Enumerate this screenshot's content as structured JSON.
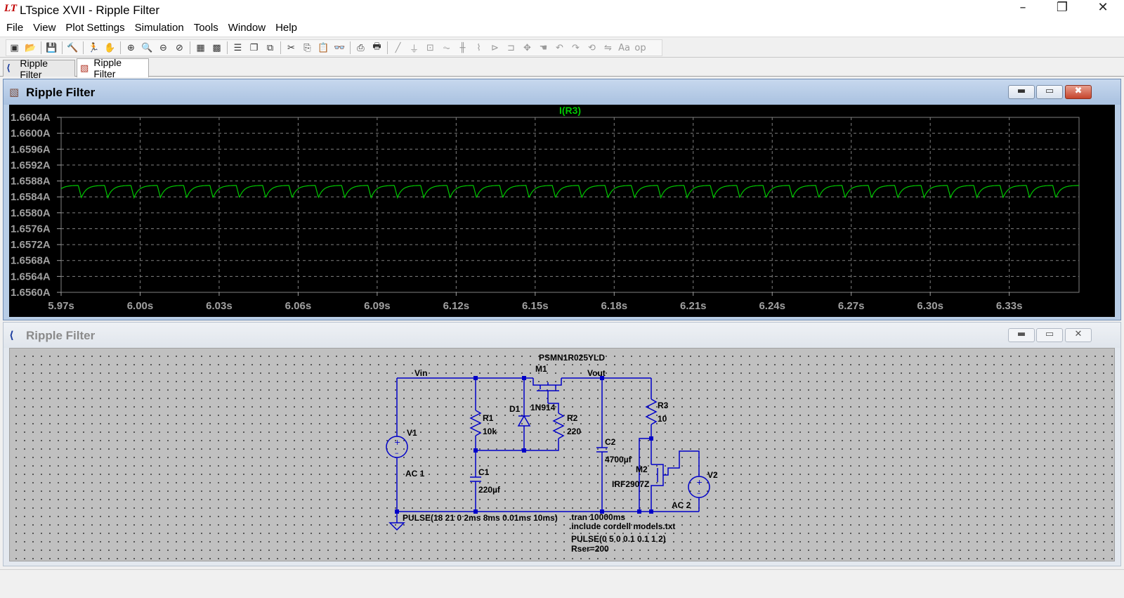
{
  "window": {
    "title": "LTspice XVII - Ripple Filter",
    "logo": "LT",
    "controls": {
      "minimize": "–",
      "maximize": "❐",
      "close": "✕"
    }
  },
  "menu": [
    "File",
    "View",
    "Plot Settings",
    "Simulation",
    "Tools",
    "Window",
    "Help"
  ],
  "toolbar": {
    "icons": [
      "new-schematic-icon",
      "open-icon",
      "sep",
      "save-icon",
      "sep",
      "control-panel-icon",
      "sep",
      "run-icon",
      "halt-icon",
      "sep",
      "zoom-in-icon",
      "zoom-box-icon",
      "zoom-out-icon",
      "zoom-cancel-icon",
      "sep",
      "autorange-icon",
      "plot-settings-icon",
      "sep",
      "tile-horizontal-icon",
      "cascade-icon",
      "tile-vertical-icon",
      "sep",
      "cut-icon",
      "copy-icon",
      "paste-icon",
      "find-icon",
      "sep",
      "print-preview-icon",
      "print-icon",
      "sep",
      "wire-icon",
      "ground-icon",
      "label-net-icon",
      "resistor-icon",
      "capacitor-icon",
      "inductor-icon",
      "diode-icon",
      "component-icon",
      "move-icon",
      "drag-icon",
      "undo-icon",
      "redo-icon",
      "rotate-icon",
      "mirror-icon",
      "text-icon",
      "spice-directive-icon"
    ],
    "glyphs": {
      "new-schematic-icon": "▣",
      "open-icon": "📂",
      "save-icon": "💾",
      "control-panel-icon": "🔨",
      "run-icon": "🏃",
      "halt-icon": "✋",
      "zoom-in-icon": "⊕",
      "zoom-box-icon": "🔍",
      "zoom-out-icon": "⊖",
      "zoom-cancel-icon": "⊘",
      "autorange-icon": "▦",
      "plot-settings-icon": "▩",
      "tile-horizontal-icon": "☰",
      "cascade-icon": "❐",
      "tile-vertical-icon": "⧉",
      "cut-icon": "✂",
      "copy-icon": "⎘",
      "paste-icon": "📋",
      "find-icon": "👓",
      "print-preview-icon": "⎙",
      "print-icon": "🖶",
      "wire-icon": "╱",
      "ground-icon": "⏚",
      "label-net-icon": "⊡",
      "resistor-icon": "⏦",
      "capacitor-icon": "╫",
      "inductor-icon": "⌇",
      "diode-icon": "⊳",
      "component-icon": "⊐",
      "move-icon": "✥",
      "drag-icon": "☚",
      "undo-icon": "↶",
      "redo-icon": "↷",
      "rotate-icon": "⟲",
      "mirror-icon": "⇋",
      "text-icon": "Aa",
      "spice-directive-icon": "op"
    }
  },
  "tabs": [
    {
      "label": "Ripple Filter",
      "icon": "schematic-tab-icon",
      "active": false
    },
    {
      "label": "Ripple Filter",
      "icon": "waveform-tab-icon",
      "active": true
    }
  ],
  "plot_window": {
    "title": "Ripple Filter",
    "ctl": {
      "min": "▬",
      "max": "▭",
      "close": "✖"
    }
  },
  "chart_data": {
    "type": "line",
    "title": "I(R3)",
    "xlabel": "",
    "ylabel": "",
    "x_ticks": [
      "5.97s",
      "6.00s",
      "6.03s",
      "6.06s",
      "6.09s",
      "6.12s",
      "6.15s",
      "6.18s",
      "6.21s",
      "6.24s",
      "6.27s",
      "6.30s",
      "6.33s"
    ],
    "y_ticks": [
      "1.6604A",
      "1.6600A",
      "1.6596A",
      "1.6592A",
      "1.6588A",
      "1.6584A",
      "1.6580A",
      "1.6576A",
      "1.6572A",
      "1.6568A",
      "1.6564A",
      "1.6560A"
    ],
    "xlim": [
      5.97,
      6.3565
    ],
    "ylim": [
      1.656,
      1.6604
    ],
    "grid": true,
    "series": [
      {
        "name": "I(R3)",
        "color": "#00c800",
        "period_s": 0.01,
        "min": 1.65838,
        "max": 1.65869,
        "x_start": 5.97,
        "x_end": 6.3565
      }
    ],
    "colors": {
      "background": "#000000",
      "grid": "#808080",
      "trace": "#00c800",
      "ticks": "#a0a0a0",
      "title": "#00c800"
    }
  },
  "schematic_window": {
    "title": "Ripple Filter",
    "ctl": {
      "min": "▬",
      "max": "▭",
      "close": "✕"
    }
  },
  "schematic": {
    "labels": {
      "mosfet1_model": "PSMN1R025YLD",
      "m1": "M1",
      "vin": "Vin",
      "vout": "Vout",
      "d1": "D1",
      "d1_model": "1N914",
      "r1": "R1",
      "r1_val": "10k",
      "r2": "R2",
      "r2_val": "220",
      "r3": "R3",
      "r3_val": "10",
      "c1": "C1",
      "c1_val": "220µf",
      "c2": "C2",
      "c2_val": "4700µf",
      "v1": "V1",
      "v1_ac": "AC 1",
      "v1_pulse": "PULSE(18 21 0 2ms 8ms 0.01ms 10ms)",
      "m2": "M2",
      "m2_model": "IRF2907Z",
      "v2": "V2",
      "v2_ac": "AC 2",
      "directive_tran": ".tran 10000ms",
      "directive_include": ".include cordell models.txt",
      "v2_pulse": "PULSE(0 5 0 0.1 0.1 1 2)",
      "v2_rser": "Rser=200"
    },
    "colors": {
      "wire": "#0000c8",
      "text": "#000000",
      "node": "#0000c8",
      "source": "#0000c8"
    }
  }
}
